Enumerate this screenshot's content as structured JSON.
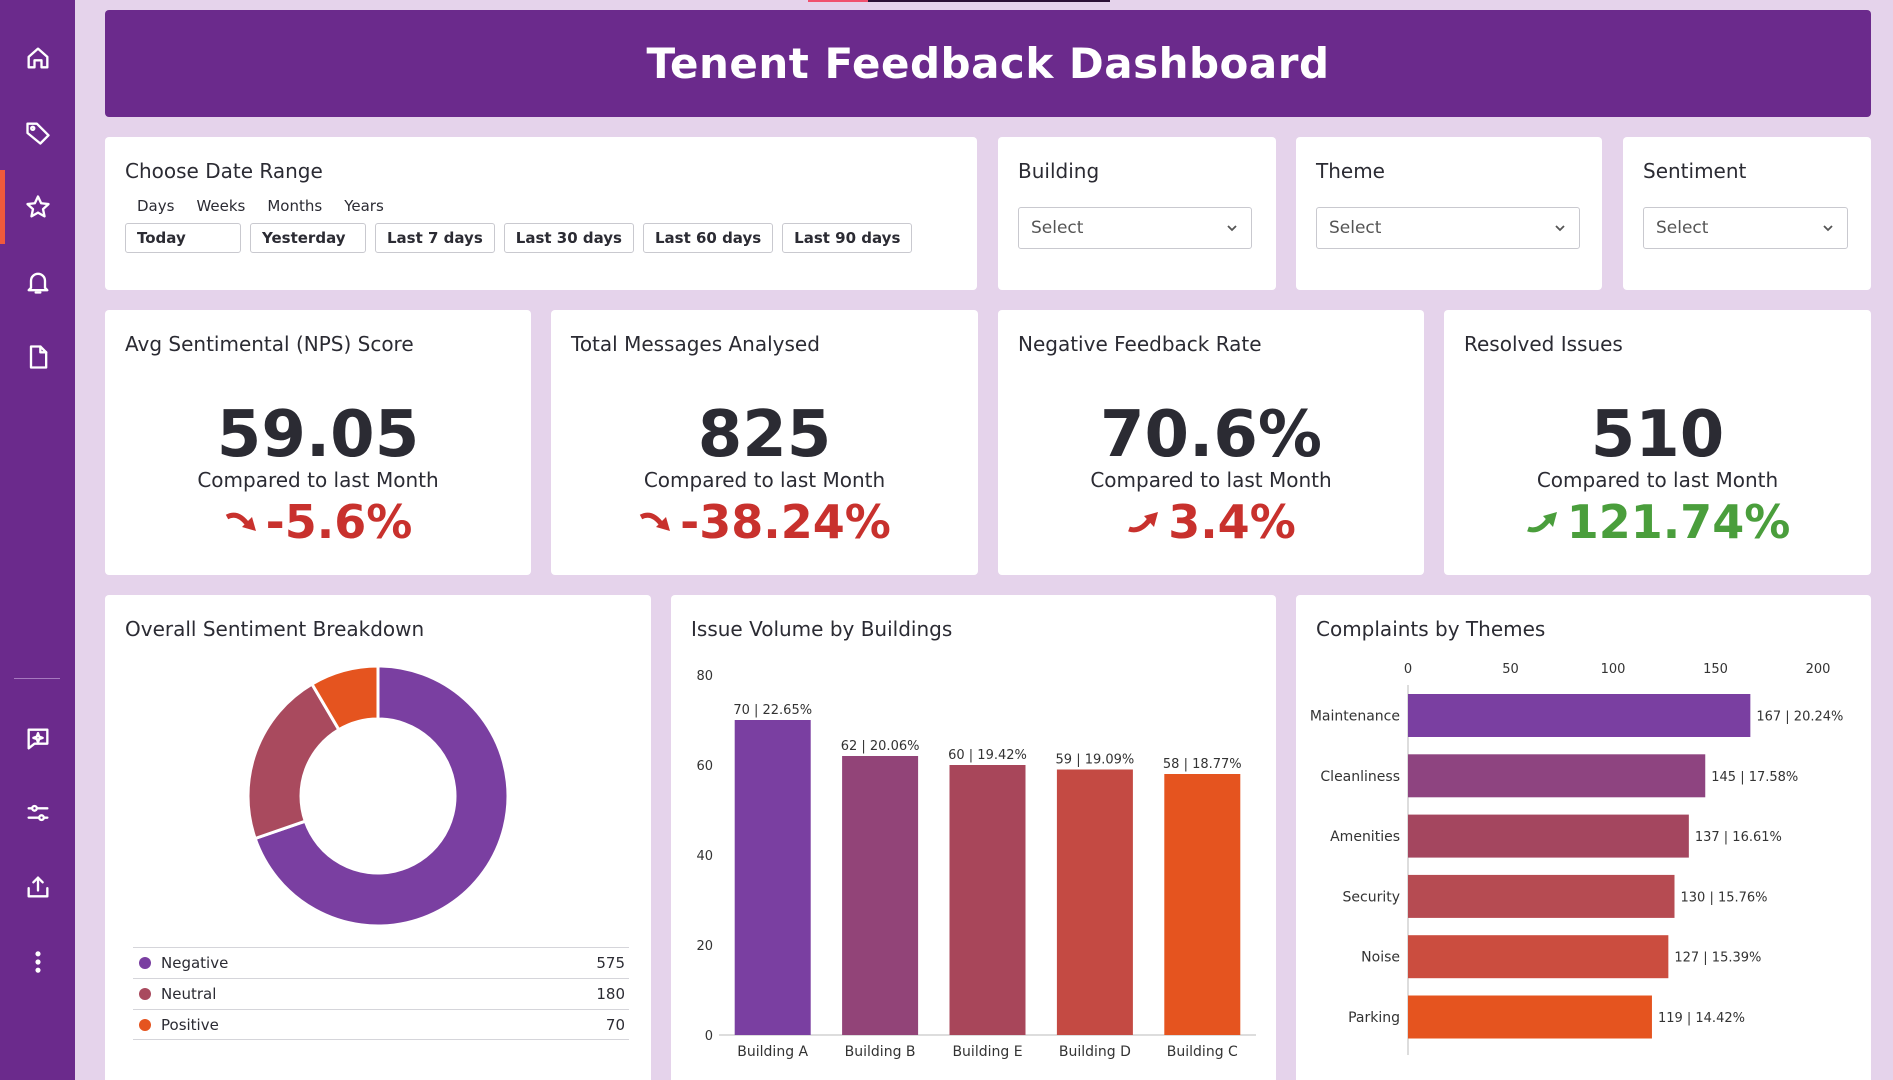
{
  "header": {
    "title": "Tenent Feedback Dashboard"
  },
  "sidebar": {
    "items": [
      {
        "icon": "home-icon"
      },
      {
        "icon": "tag-icon"
      },
      {
        "icon": "star-icon",
        "active": true
      },
      {
        "icon": "bell-icon"
      },
      {
        "icon": "document-icon"
      },
      {
        "icon": "sparkle-chat-icon"
      },
      {
        "icon": "sliders-icon"
      },
      {
        "icon": "export-icon"
      },
      {
        "icon": "more-vertical-icon"
      }
    ]
  },
  "filters": {
    "date_range": {
      "title": "Choose Date Range",
      "tabs": [
        "Days",
        "Weeks",
        "Months",
        "Years"
      ],
      "buttons": [
        "Today",
        "Yesterday",
        "Last 7 days",
        "Last 30 days",
        "Last 60 days",
        "Last 90 days"
      ]
    },
    "building": {
      "title": "Building",
      "value": "Select"
    },
    "theme": {
      "title": "Theme",
      "value": "Select"
    },
    "sentiment": {
      "title": "Sentiment",
      "value": "Select"
    }
  },
  "kpis": [
    {
      "title": "Avg Sentimental (NPS) Score",
      "value": "59.05",
      "subtitle": "Compared to last Month",
      "change": "-5.6%",
      "direction": "down",
      "color": "#c8312d"
    },
    {
      "title": "Total Messages Analysed",
      "value": "825",
      "subtitle": "Compared to last Month",
      "change": "-38.24%",
      "direction": "down",
      "color": "#c8312d"
    },
    {
      "title": "Negative Feedback Rate",
      "value": "70.6%",
      "subtitle": "Compared to last Month",
      "change": "3.4%",
      "direction": "up",
      "color": "#c8312d"
    },
    {
      "title": "Resolved Issues",
      "value": "510",
      "subtitle": "Compared to last Month",
      "change": "121.74%",
      "direction": "up",
      "color": "#4a9e3c"
    }
  ],
  "colors": {
    "purple": "#6b2a8c",
    "negative": "#7a3fa1",
    "neutral": "#a94a5e",
    "positive": "#e5541f"
  },
  "chart_data": [
    {
      "type": "pie",
      "title": "Overall Sentiment Breakdown",
      "categories": [
        "Negative",
        "Neutral",
        "Positive"
      ],
      "values": [
        575,
        180,
        70
      ],
      "colors": [
        "#7a3fa1",
        "#a94a5e",
        "#e5541f"
      ],
      "labels": [
        "575",
        "180",
        "70"
      ]
    },
    {
      "type": "bar",
      "title": "Issue Volume by Buildings",
      "categories": [
        "Building A",
        "Building B",
        "Building E",
        "Building D",
        "Building C"
      ],
      "values": [
        70,
        62,
        60,
        59,
        58
      ],
      "labels": [
        "70  | 22.65%",
        "62  | 20.06%",
        "60  | 19.42%",
        "59  | 19.09%",
        "58  | 18.77%"
      ],
      "colors": [
        "#7a3fa1",
        "#924478",
        "#a8465a",
        "#c44a43",
        "#e5541f"
      ],
      "ylim": [
        0,
        80
      ],
      "yticks": [
        "0",
        "20",
        "40",
        "60",
        "80"
      ]
    },
    {
      "type": "bar",
      "orientation": "horizontal",
      "title": "Complaints by Themes",
      "categories": [
        "Maintenance",
        "Cleanliness",
        "Amenities",
        "Security",
        "Noise",
        "Parking"
      ],
      "values": [
        167,
        145,
        137,
        130,
        127,
        119
      ],
      "labels": [
        "167  | 20.24%",
        "145  | 17.58%",
        "137  | 16.61%",
        "130  | 15.76%",
        "127  | 15.39%",
        "119  | 14.42%"
      ],
      "colors": [
        "#7a3fa1",
        "#8e4480",
        "#a4465f",
        "#b64b52",
        "#cb4d3f",
        "#e5541f"
      ],
      "xlim": [
        0,
        200
      ],
      "xticks": [
        "0",
        "50",
        "100",
        "150",
        "200"
      ]
    }
  ]
}
